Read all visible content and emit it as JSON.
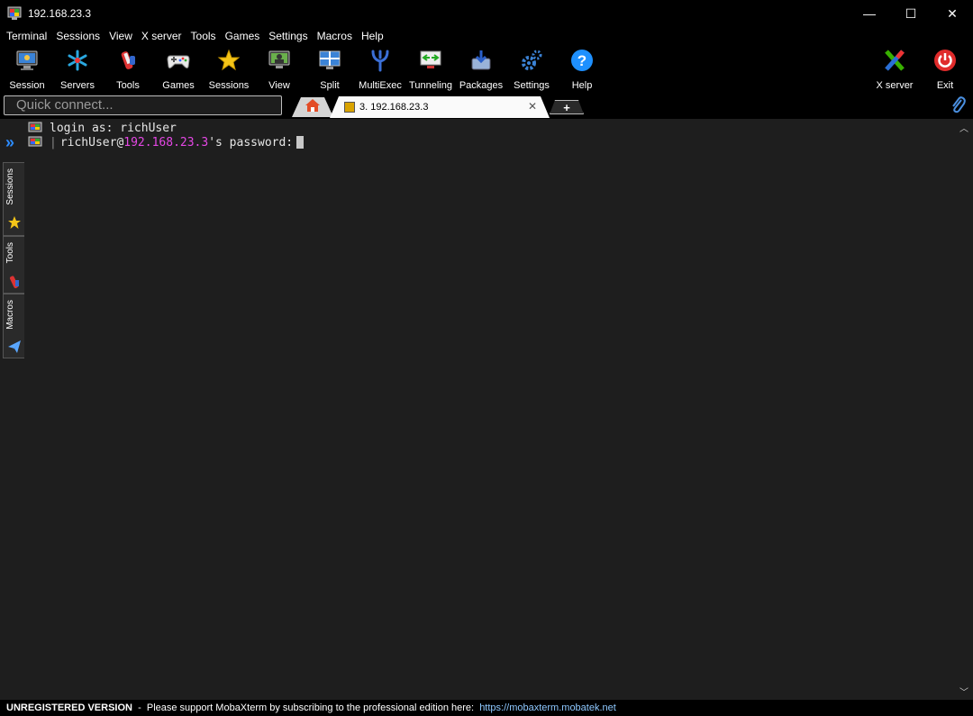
{
  "window": {
    "title": "192.168.23.3",
    "minimize": "—",
    "maximize": "☐",
    "close": "✕"
  },
  "menu": [
    "Terminal",
    "Sessions",
    "View",
    "X server",
    "Tools",
    "Games",
    "Settings",
    "Macros",
    "Help"
  ],
  "toolbar": {
    "session": "Session",
    "servers": "Servers",
    "tools": "Tools",
    "games": "Games",
    "sessions": "Sessions",
    "view": "View",
    "split": "Split",
    "multiexec": "MultiExec",
    "tunneling": "Tunneling",
    "packages": "Packages",
    "settings": "Settings",
    "help": "Help",
    "xserver": "X server",
    "exit": "Exit"
  },
  "quick_connect": {
    "placeholder": "Quick connect..."
  },
  "tabs": {
    "active_label": "3. 192.168.23.3",
    "close": "✕",
    "new": "+"
  },
  "side_tabs": {
    "sessions": "Sessions",
    "tools": "Tools",
    "macros": "Macros"
  },
  "terminal": {
    "line1": "login as: richUser",
    "line2_user": "richUser@",
    "line2_host": "192.168.23.3",
    "line2_rest": "'s password:"
  },
  "status": {
    "unregistered": "UNREGISTERED VERSION",
    "message": "  -  Please support MobaXterm by subscribing to the professional edition here:  ",
    "link": "https://mobaxterm.mobatek.net"
  },
  "colors": {
    "terminal_bg": "#1e1e1e",
    "host": "#e547e5",
    "link": "#8ec8ff",
    "accent": "#2c8cff"
  }
}
